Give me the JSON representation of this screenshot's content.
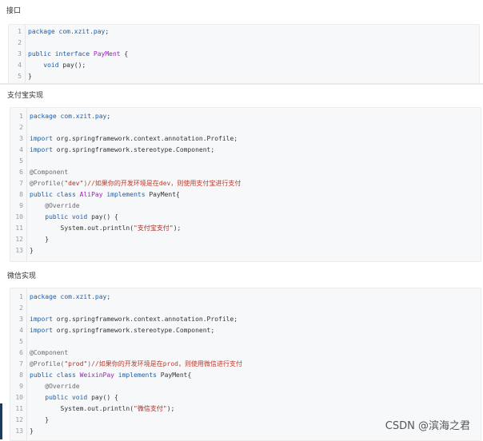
{
  "sections": [
    {
      "title": "接口",
      "lines": [
        [
          {
            "t": "package ",
            "c": "kw"
          },
          {
            "t": "com.xzit.pay",
            "c": "pkg"
          },
          {
            "t": ";",
            "c": ""
          }
        ],
        [],
        [
          {
            "t": "public interface ",
            "c": "kw"
          },
          {
            "t": "PayMent",
            "c": "cls"
          },
          {
            "t": " {",
            "c": ""
          }
        ],
        [
          {
            "t": "    ",
            "c": ""
          },
          {
            "t": "void",
            "c": "kw"
          },
          {
            "t": " pay();",
            "c": ""
          }
        ],
        [
          {
            "t": "}",
            "c": ""
          }
        ]
      ]
    },
    {
      "title": "支付宝实现",
      "lines": [
        [
          {
            "t": "package ",
            "c": "kw"
          },
          {
            "t": "com.xzit.pay",
            "c": "pkg"
          },
          {
            "t": ";",
            "c": ""
          }
        ],
        [],
        [
          {
            "t": "import ",
            "c": "kw"
          },
          {
            "t": "org.springframework.context.annotation.Profile;",
            "c": ""
          }
        ],
        [
          {
            "t": "import ",
            "c": "kw"
          },
          {
            "t": "org.springframework.stereotype.Component;",
            "c": ""
          }
        ],
        [],
        [
          {
            "t": "@Component",
            "c": "ann"
          }
        ],
        [
          {
            "t": "@Profile(",
            "c": "ann"
          },
          {
            "t": "\"dev\"",
            "c": "str"
          },
          {
            "t": ")",
            "c": "ann"
          },
          {
            "t": "//如果你的开发环境是在dev，则使用支付宝进行支付",
            "c": "cmt"
          }
        ],
        [
          {
            "t": "public class ",
            "c": "kw"
          },
          {
            "t": "AliPay",
            "c": "cls"
          },
          {
            "t": " implements ",
            "c": "kw"
          },
          {
            "t": "PayMent{",
            "c": ""
          }
        ],
        [
          {
            "t": "    ",
            "c": ""
          },
          {
            "t": "@Override",
            "c": "ann"
          }
        ],
        [
          {
            "t": "    ",
            "c": ""
          },
          {
            "t": "public void",
            "c": "kw"
          },
          {
            "t": " pay() {",
            "c": ""
          }
        ],
        [
          {
            "t": "        System.out.println(",
            "c": ""
          },
          {
            "t": "\"支付宝支付\"",
            "c": "str"
          },
          {
            "t": ");",
            "c": ""
          }
        ],
        [
          {
            "t": "    }",
            "c": ""
          }
        ],
        [
          {
            "t": "}",
            "c": ""
          }
        ]
      ]
    },
    {
      "title": "微信实现",
      "lines": [
        [
          {
            "t": "package ",
            "c": "kw"
          },
          {
            "t": "com.xzit.pay",
            "c": "pkg"
          },
          {
            "t": ";",
            "c": ""
          }
        ],
        [],
        [
          {
            "t": "import ",
            "c": "kw"
          },
          {
            "t": "org.springframework.context.annotation.Profile;",
            "c": ""
          }
        ],
        [
          {
            "t": "import ",
            "c": "kw"
          },
          {
            "t": "org.springframework.stereotype.Component;",
            "c": ""
          }
        ],
        [],
        [
          {
            "t": "@Component",
            "c": "ann"
          }
        ],
        [
          {
            "t": "@Profile(",
            "c": "ann"
          },
          {
            "t": "\"prod\"",
            "c": "str"
          },
          {
            "t": ")",
            "c": "ann"
          },
          {
            "t": "//如果你的开发环境是在prod，则使用微信进行支付",
            "c": "cmt"
          }
        ],
        [
          {
            "t": "public class ",
            "c": "kw"
          },
          {
            "t": "WeixinPay",
            "c": "cls"
          },
          {
            "t": " implements ",
            "c": "kw"
          },
          {
            "t": "PayMent{",
            "c": ""
          }
        ],
        [
          {
            "t": "    ",
            "c": ""
          },
          {
            "t": "@Override",
            "c": "ann"
          }
        ],
        [
          {
            "t": "    ",
            "c": ""
          },
          {
            "t": "public void",
            "c": "kw"
          },
          {
            "t": " pay() {",
            "c": ""
          }
        ],
        [
          {
            "t": "        System.out.println(",
            "c": ""
          },
          {
            "t": "\"微信支付\"",
            "c": "str"
          },
          {
            "t": ");",
            "c": ""
          }
        ],
        [
          {
            "t": "    }",
            "c": ""
          }
        ],
        [
          {
            "t": "}",
            "c": ""
          }
        ]
      ]
    }
  ],
  "watermark": "CSDN @滨海之君"
}
